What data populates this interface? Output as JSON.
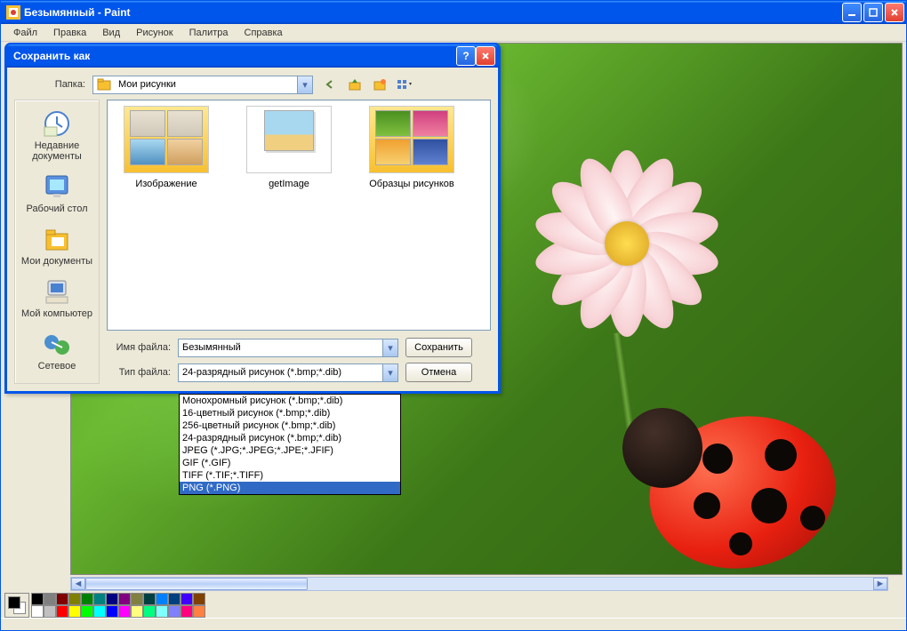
{
  "titlebar": {
    "title": "Безымянный - Paint"
  },
  "menu": {
    "file": "Файл",
    "edit": "Правка",
    "view": "Вид",
    "image": "Рисунок",
    "palette": "Палитра",
    "help": "Справка"
  },
  "dialog": {
    "title": "Сохранить как",
    "folder_label": "Папка:",
    "folder_value": "Мои рисунки",
    "places": {
      "recent": "Недавние документы",
      "desktop": "Рабочий стол",
      "mydocs": "Мои документы",
      "mycomputer": "Мой компьютер",
      "network": "Сетевое"
    },
    "files": {
      "f1": "Изображение",
      "f2": "getImage",
      "f3": "Образцы рисунков"
    },
    "filename_label": "Имя файла:",
    "filename_value": "Безымянный",
    "filetype_label": "Тип файла:",
    "filetype_value": "24-разрядный рисунок (*.bmp;*.dib)",
    "save_btn": "Сохранить",
    "cancel_btn": "Отмена",
    "type_options": [
      "Монохромный рисунок (*.bmp;*.dib)",
      "16-цветный рисунок (*.bmp;*.dib)",
      "256-цветный рисунок (*.bmp;*.dib)",
      "24-разрядный рисунок (*.bmp;*.dib)",
      "JPEG (*.JPG;*.JPEG;*.JPE;*.JFIF)",
      "GIF (*.GIF)",
      "TIFF (*.TIF;*.TIFF)",
      "PNG (*.PNG)"
    ],
    "selected_option_index": 7
  },
  "palette_colors_top": [
    "#000000",
    "#808080",
    "#800000",
    "#808000",
    "#008000",
    "#008080",
    "#000080",
    "#800080",
    "#808040",
    "#004040",
    "#0080ff",
    "#004080",
    "#4000ff",
    "#804000"
  ],
  "palette_colors_bottom": [
    "#ffffff",
    "#c0c0c0",
    "#ff0000",
    "#ffff00",
    "#00ff00",
    "#00ffff",
    "#0000ff",
    "#ff00ff",
    "#ffff80",
    "#00ff80",
    "#80ffff",
    "#8080ff",
    "#ff0080",
    "#ff8040"
  ]
}
